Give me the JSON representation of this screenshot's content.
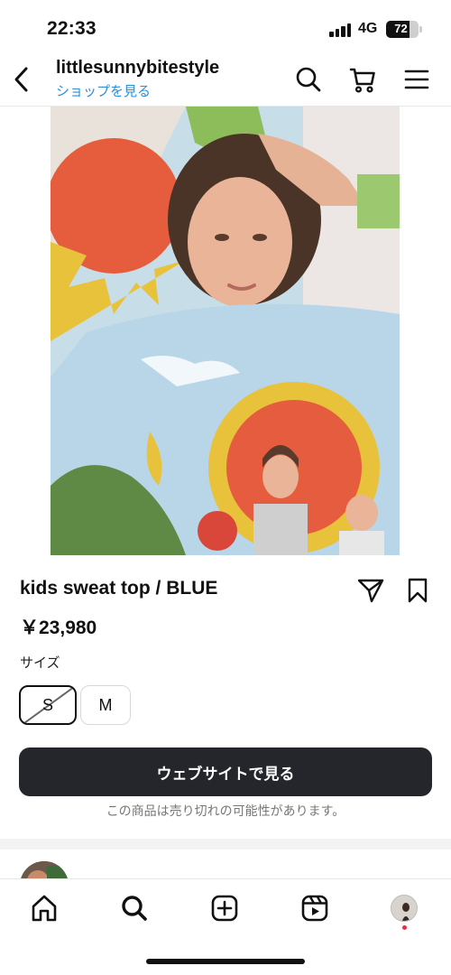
{
  "status_bar": {
    "time": "22:33",
    "network": "4G",
    "battery": "72",
    "battery_level": 0.72
  },
  "header": {
    "back_icon": "chevron-left-icon",
    "shop_name": "littlesunnybitestyle",
    "shop_link": "ショップを見る",
    "icons": [
      "search-icon",
      "cart-icon",
      "menu-icon"
    ]
  },
  "product": {
    "image": "product-photo",
    "title": "kids sweat top / BLUE",
    "price": "￥23,980",
    "share_icon": "send-icon",
    "save_icon": "bookmark-icon",
    "size_label": "サイズ",
    "sizes": [
      {
        "label": "S",
        "selected": true,
        "sold_out": true
      },
      {
        "label": "M",
        "selected": false,
        "sold_out": false
      }
    ],
    "cta_label": "ウェブサイトで見る",
    "disclaimer": "この商品は売り切れの可能性があります。"
  },
  "bottom_nav": {
    "items": [
      "home-icon",
      "search-icon",
      "create-icon",
      "reels-icon",
      "profile-avatar"
    ]
  },
  "colors": {
    "link": "#2b8fd8",
    "cta_bg": "#24262b",
    "notification": "#e8303f"
  }
}
